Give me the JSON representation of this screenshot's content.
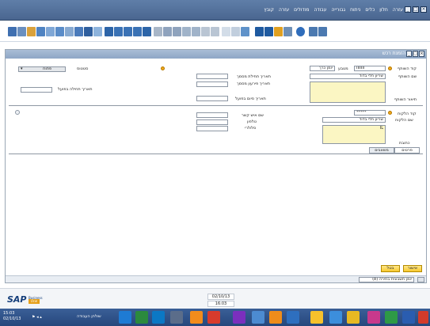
{
  "menubar": {
    "items": [
      "עזרה",
      "חלון",
      "כלים",
      "ניתוח",
      "גבורייה",
      "עבודה",
      "מודולים",
      "עזרה",
      "קובץ"
    ]
  },
  "document": {
    "title": "הזמנת רכש"
  },
  "header_left": {
    "status_label": "סטטוס",
    "status_value": "פתוח",
    "doc_date_label": "תאריך תחילת מסמך",
    "delivery_date_label": "תאריך פירעון מסמך",
    "valid_until_label": "תאריך תחילה בפועל",
    "posting_date_label": "תאריך סיום בפועל"
  },
  "header_right": {
    "vendor_code_label": "קוד השותף",
    "vendor_code_value": "IIIIIII",
    "vendor_name_label": "שם השותף",
    "vendor_name_value": "שריון חלי בדוד",
    "currency_label": "מטבע",
    "currency_value": "יומן כרך",
    "owner_label": "תיאור השותף"
  },
  "contact": {
    "contact_code_label": "קוד הלקוח",
    "contact_code_value": "*****",
    "contact_name_label": "שם הלקוח",
    "contact_name_value": "שריון חלי בדוד",
    "address_label": "כתובת",
    "address_value": "IL"
  },
  "mid_left": {
    "contact_person_label": "שם איש קשר",
    "phone_label": "טלפון",
    "mobile_label": "סלולרי"
  },
  "tabs": [
    "פרטים",
    "משאבים"
  ],
  "buttons": {
    "ok": "אישור",
    "cancel": "בטל"
  },
  "doc_status": {
    "text": "יומן חשבונית בחירה (8)"
  },
  "sapbar": {
    "brand": "SAP",
    "brand_small": "Business",
    "brand_one": "One",
    "date": "02/10/13",
    "time": "16:03"
  },
  "taskbar": {
    "time": "15:03",
    "date": "02/10/13",
    "lang": "שולחן העבודה"
  },
  "colors": {
    "menubar": "#4e6c96",
    "yellow_field": "#fbf6c3",
    "button_yellow": "#f7c92f",
    "taskbar": "#26477c"
  }
}
